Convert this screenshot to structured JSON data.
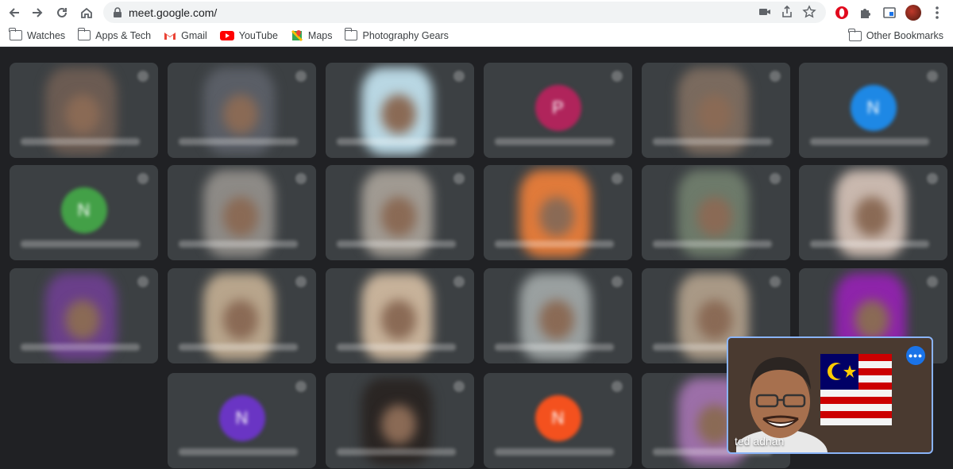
{
  "browser": {
    "url": "meet.google.com/",
    "bookmarks": [
      {
        "label": "Watches",
        "icon": "folder-icon"
      },
      {
        "label": "Apps & Tech",
        "icon": "folder-icon"
      },
      {
        "label": "Gmail",
        "icon": "gmail-icon"
      },
      {
        "label": "YouTube",
        "icon": "youtube-icon"
      },
      {
        "label": "Maps",
        "icon": "maps-icon"
      },
      {
        "label": "Photography Gears",
        "icon": "folder-icon"
      }
    ],
    "other_bookmarks": "Other Bookmarks"
  },
  "meet": {
    "self_view_name": "ted adnan",
    "more_options": "•••",
    "tiles": [
      {
        "letter": "",
        "color": "#6b5b52"
      },
      {
        "letter": "",
        "color": "#5a5e66"
      },
      {
        "letter": "",
        "color": "#b9d7e3"
      },
      {
        "letter": "P",
        "color": "#b0245b"
      },
      {
        "letter": "",
        "color": "#7a6a5e"
      },
      {
        "letter": "N",
        "color": "#1e88e5"
      },
      {
        "letter": "N",
        "color": "#43a047"
      },
      {
        "letter": "",
        "color": "#8d8a86"
      },
      {
        "letter": "",
        "color": "#a09a92"
      },
      {
        "letter": "",
        "color": "#e07a3a"
      },
      {
        "letter": "",
        "color": "#6d7a6a"
      },
      {
        "letter": "",
        "color": "#c9b8ae"
      },
      {
        "letter": "",
        "color": "#6a3f8a"
      },
      {
        "letter": "",
        "color": "#b8a58c"
      },
      {
        "letter": "",
        "color": "#c7b29a"
      },
      {
        "letter": "",
        "color": "#9aa0a0"
      },
      {
        "letter": "",
        "color": "#a99986"
      },
      {
        "letter": "",
        "color": "#8e24aa"
      },
      {
        "letter": "N",
        "color": "#6a35c4"
      },
      {
        "letter": "",
        "color": "#2a2523"
      },
      {
        "letter": "N",
        "color": "#f4511e"
      },
      {
        "letter": "",
        "color": "#9c6fa8"
      }
    ]
  }
}
